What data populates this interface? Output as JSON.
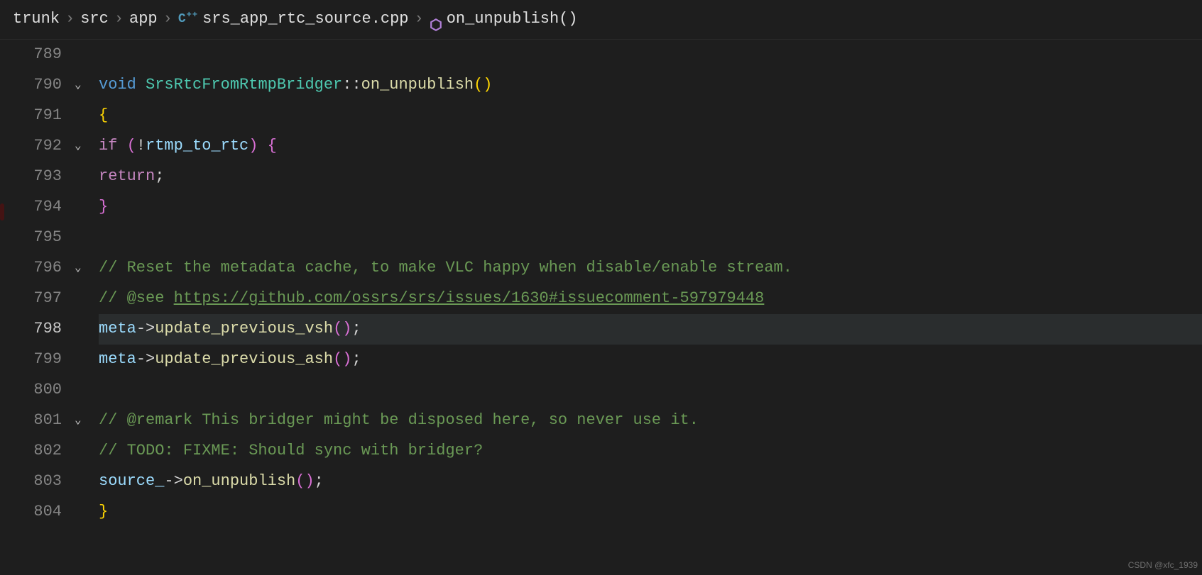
{
  "breadcrumbs": {
    "items": [
      "trunk",
      "src",
      "app",
      "srs_app_rtc_source.cpp",
      "on_unpublish()"
    ]
  },
  "watermark": "CSDN @xfc_1939",
  "gutter": {
    "start": 789,
    "end": 804,
    "active": 798,
    "folds": {
      "790": true,
      "792": true,
      "796": true,
      "801": true
    }
  },
  "code": {
    "789": {
      "raw": ""
    },
    "790": {
      "tokens": [
        {
          "t": "kw",
          "v": "void"
        },
        {
          "t": "op",
          "v": " "
        },
        {
          "t": "type",
          "v": "SrsRtcFromRtmpBridger"
        },
        {
          "t": "op",
          "v": "::"
        },
        {
          "t": "fn",
          "v": "on_unpublish"
        },
        {
          "t": "br-y",
          "v": "()"
        }
      ]
    },
    "791": {
      "tokens": [
        {
          "t": "br-y",
          "v": "{"
        }
      ]
    },
    "792": {
      "indent": 1,
      "tokens": [
        {
          "t": "ctl",
          "v": "if"
        },
        {
          "t": "op",
          "v": " "
        },
        {
          "t": "br-p",
          "v": "("
        },
        {
          "t": "op",
          "v": "!"
        },
        {
          "t": "var",
          "v": "rtmp_to_rtc"
        },
        {
          "t": "br-p",
          "v": ")"
        },
        {
          "t": "op",
          "v": " "
        },
        {
          "t": "br-p",
          "v": "{"
        }
      ]
    },
    "793": {
      "indent": 2,
      "tokens": [
        {
          "t": "ctl",
          "v": "return"
        },
        {
          "t": "op",
          "v": ";"
        }
      ]
    },
    "794": {
      "indent": 1,
      "tokens": [
        {
          "t": "br-p",
          "v": "}"
        }
      ]
    },
    "795": {
      "raw": ""
    },
    "796": {
      "indent": 1,
      "tokens": [
        {
          "t": "cm",
          "v": "// Reset the metadata cache, to make VLC happy when disable/enable stream."
        }
      ]
    },
    "797": {
      "indent": 1,
      "tokens": [
        {
          "t": "cm",
          "v": "// @see ",
          "link": "https://github.com/ossrs/srs/issues/1630#issuecomment-597979448"
        }
      ]
    },
    "798": {
      "indent": 1,
      "tokens": [
        {
          "t": "var",
          "v": "meta"
        },
        {
          "t": "op",
          "v": "->"
        },
        {
          "t": "fn",
          "v": "update_previous_vsh"
        },
        {
          "t": "br-p",
          "v": "()"
        },
        {
          "t": "op",
          "v": ";"
        }
      ]
    },
    "799": {
      "indent": 1,
      "tokens": [
        {
          "t": "var",
          "v": "meta"
        },
        {
          "t": "op",
          "v": "->"
        },
        {
          "t": "fn",
          "v": "update_previous_ash"
        },
        {
          "t": "br-p",
          "v": "()"
        },
        {
          "t": "op",
          "v": ";"
        }
      ]
    },
    "800": {
      "raw": ""
    },
    "801": {
      "indent": 1,
      "tokens": [
        {
          "t": "cm",
          "v": "// @remark This bridger might be disposed here, so never use it."
        }
      ]
    },
    "802": {
      "indent": 1,
      "tokens": [
        {
          "t": "cm",
          "v": "// TODO: FIXME: Should sync with bridger?"
        }
      ]
    },
    "803": {
      "indent": 1,
      "tokens": [
        {
          "t": "var",
          "v": "source_"
        },
        {
          "t": "op",
          "v": "->"
        },
        {
          "t": "fn",
          "v": "on_unpublish"
        },
        {
          "t": "br-p",
          "v": "()"
        },
        {
          "t": "op",
          "v": ";"
        }
      ]
    },
    "804": {
      "tokens": [
        {
          "t": "br-y",
          "v": "}"
        }
      ]
    }
  }
}
